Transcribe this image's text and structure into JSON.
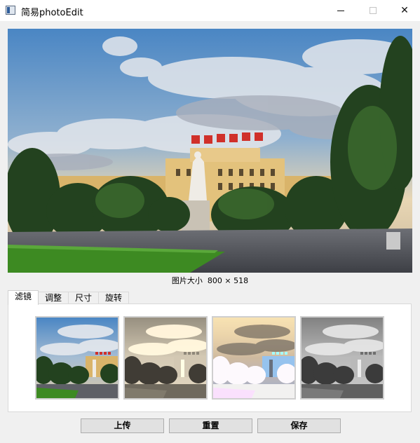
{
  "window": {
    "title": "简易photoEdit",
    "minimize_glyph": "—",
    "maximize_glyph": "☐",
    "close_glyph": "✕"
  },
  "image_info": {
    "size_text": "图片大小  800 × 518"
  },
  "tabs": [
    {
      "label": "滤镜",
      "active": true
    },
    {
      "label": "调整",
      "active": false
    },
    {
      "label": "尺寸",
      "active": false
    },
    {
      "label": "旋转",
      "active": false
    }
  ],
  "filters": [
    {
      "name": "original"
    },
    {
      "name": "sepia"
    },
    {
      "name": "invert"
    },
    {
      "name": "grayscale"
    }
  ],
  "buttons": {
    "upload": "上传",
    "reset": "重置",
    "save": "保存"
  },
  "colors": {
    "window_bg": "#f0f0f0",
    "button_bg": "#e1e1e1",
    "button_border": "#adadad"
  }
}
